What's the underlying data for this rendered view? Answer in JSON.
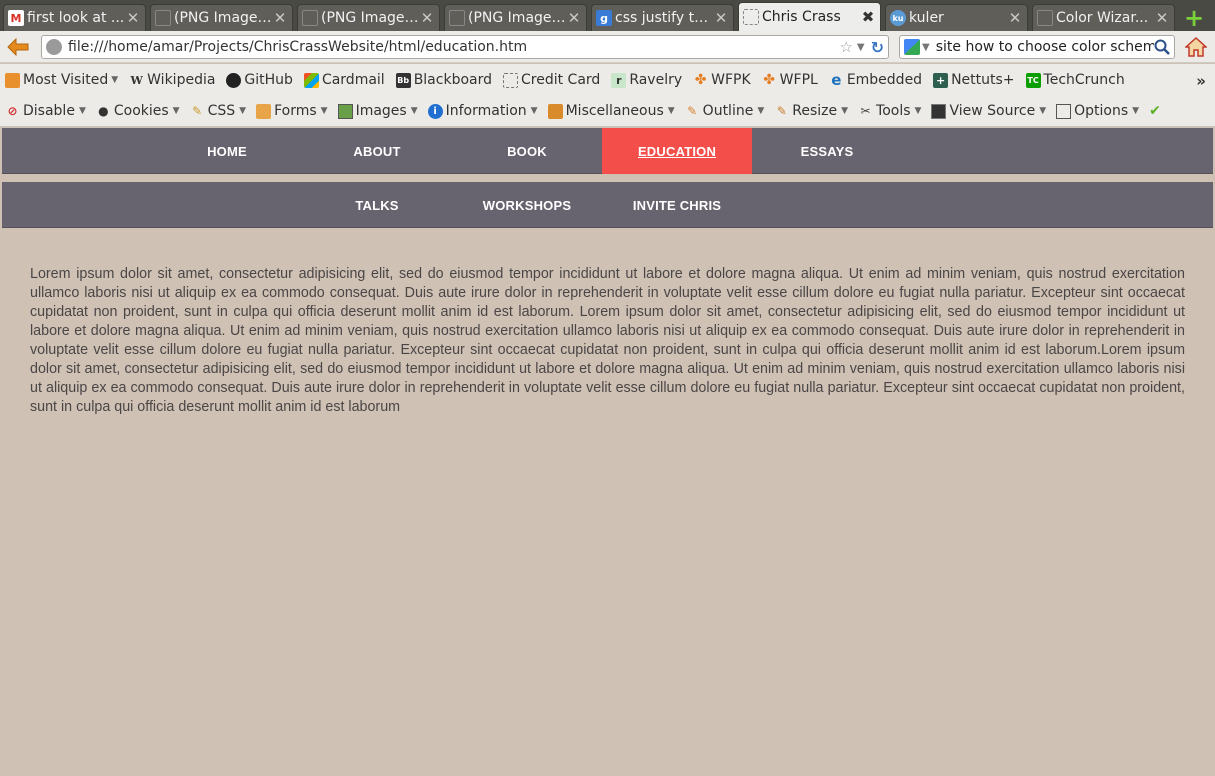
{
  "tabs": [
    {
      "title": "first look at ...",
      "icon": "gmail-icon",
      "color": "#d93025"
    },
    {
      "title": "(PNG Image,...",
      "icon": "image-icon",
      "color": "#777777"
    },
    {
      "title": "(PNG Image,...",
      "icon": "image-icon",
      "color": "#777777"
    },
    {
      "title": "(PNG Image,...",
      "icon": "image-icon",
      "color": "#777777"
    },
    {
      "title": "css justify te...",
      "icon": "google-icon",
      "color": "#3a7bd5"
    },
    {
      "title": "Chris Crass",
      "icon": "page-icon",
      "color": "#ffffff",
      "active": true
    },
    {
      "title": "kuler",
      "icon": "kuler-icon",
      "color": "#5b9bd5"
    },
    {
      "title": "Color Wizar...",
      "icon": "page-icon",
      "color": "#777777"
    }
  ],
  "navbar": {
    "url": "file:///home/amar/Projects/ChrisCrassWebsite/html/education.htm",
    "search_text": "site how to choose color scheme"
  },
  "bookmarks": [
    {
      "label": "Most Visited",
      "icon": "most-visited-icon",
      "dropdown": true
    },
    {
      "label": "Wikipedia",
      "icon": "wikipedia-icon"
    },
    {
      "label": "GitHub",
      "icon": "github-icon"
    },
    {
      "label": "Cardmail",
      "icon": "cardmail-icon"
    },
    {
      "label": "Blackboard",
      "icon": "blackboard-icon"
    },
    {
      "label": "Credit Card",
      "icon": "page-icon"
    },
    {
      "label": "Ravelry",
      "icon": "ravelry-icon"
    },
    {
      "label": "WFPK",
      "icon": "wfpk-icon"
    },
    {
      "label": "WFPL",
      "icon": "wfpl-icon"
    },
    {
      "label": "Embedded",
      "icon": "embedded-icon"
    },
    {
      "label": "Nettuts+",
      "icon": "nettuts-icon"
    },
    {
      "label": "TechCrunch",
      "icon": "techcrunch-icon"
    }
  ],
  "devtools": [
    {
      "label": "Disable",
      "icon": "disable-icon"
    },
    {
      "label": "Cookies",
      "icon": "cookies-icon"
    },
    {
      "label": "CSS",
      "icon": "css-icon"
    },
    {
      "label": "Forms",
      "icon": "forms-icon"
    },
    {
      "label": "Images",
      "icon": "images-icon"
    },
    {
      "label": "Information",
      "icon": "information-icon"
    },
    {
      "label": "Miscellaneous",
      "icon": "miscellaneous-icon"
    },
    {
      "label": "Outline",
      "icon": "outline-icon"
    },
    {
      "label": "Resize",
      "icon": "resize-icon"
    },
    {
      "label": "Tools",
      "icon": "tools-icon"
    },
    {
      "label": "View Source",
      "icon": "view-source-icon"
    },
    {
      "label": "Options",
      "icon": "options-icon"
    }
  ],
  "site": {
    "main_nav": [
      "HOME",
      "ABOUT",
      "BOOK",
      "EDUCATION",
      "ESSAYS"
    ],
    "active_nav": "EDUCATION",
    "sub_nav": [
      "TALKS",
      "WORKSHOPS",
      "INVITE CHRIS"
    ],
    "body_text": "Lorem ipsum dolor sit amet, consectetur adipisicing elit, sed do eiusmod tempor incididunt ut labore et dolore magna aliqua. Ut enim ad minim veniam, quis nostrud exercitation ullamco laboris nisi ut aliquip ex ea commodo consequat. Duis aute irure dolor in reprehenderit in voluptate velit esse cillum dolore eu fugiat nulla pariatur. Excepteur sint occaecat cupidatat non proident, sunt in culpa qui officia deserunt mollit anim id est laborum. Lorem ipsum dolor sit amet, consectetur adipisicing elit, sed do eiusmod tempor incididunt ut labore et dolore magna aliqua. Ut enim ad minim veniam, quis nostrud exercitation ullamco laboris nisi ut aliquip ex ea commodo consequat. Duis aute irure dolor in reprehenderit in voluptate velit esse cillum dolore eu fugiat nulla pariatur. Excepteur sint occaecat cupidatat non proident, sunt in culpa qui officia deserunt mollit anim id est laborum.Lorem ipsum dolor sit amet, consectetur adipisicing elit, sed do eiusmod tempor incididunt ut labore et dolore magna aliqua. Ut enim ad minim veniam, quis nostrud exercitation ullamco laboris nisi ut aliquip ex ea commodo consequat. Duis aute irure dolor in reprehenderit in voluptate velit esse cillum dolore eu fugiat nulla pariatur. Excepteur sint occaecat cupidatat non proident, sunt in culpa qui officia deserunt mollit anim id est laborum"
  },
  "colors": {
    "nav_background": "#68646f",
    "active_nav": "#f44e4a",
    "page_background": "#d0c1b5"
  }
}
